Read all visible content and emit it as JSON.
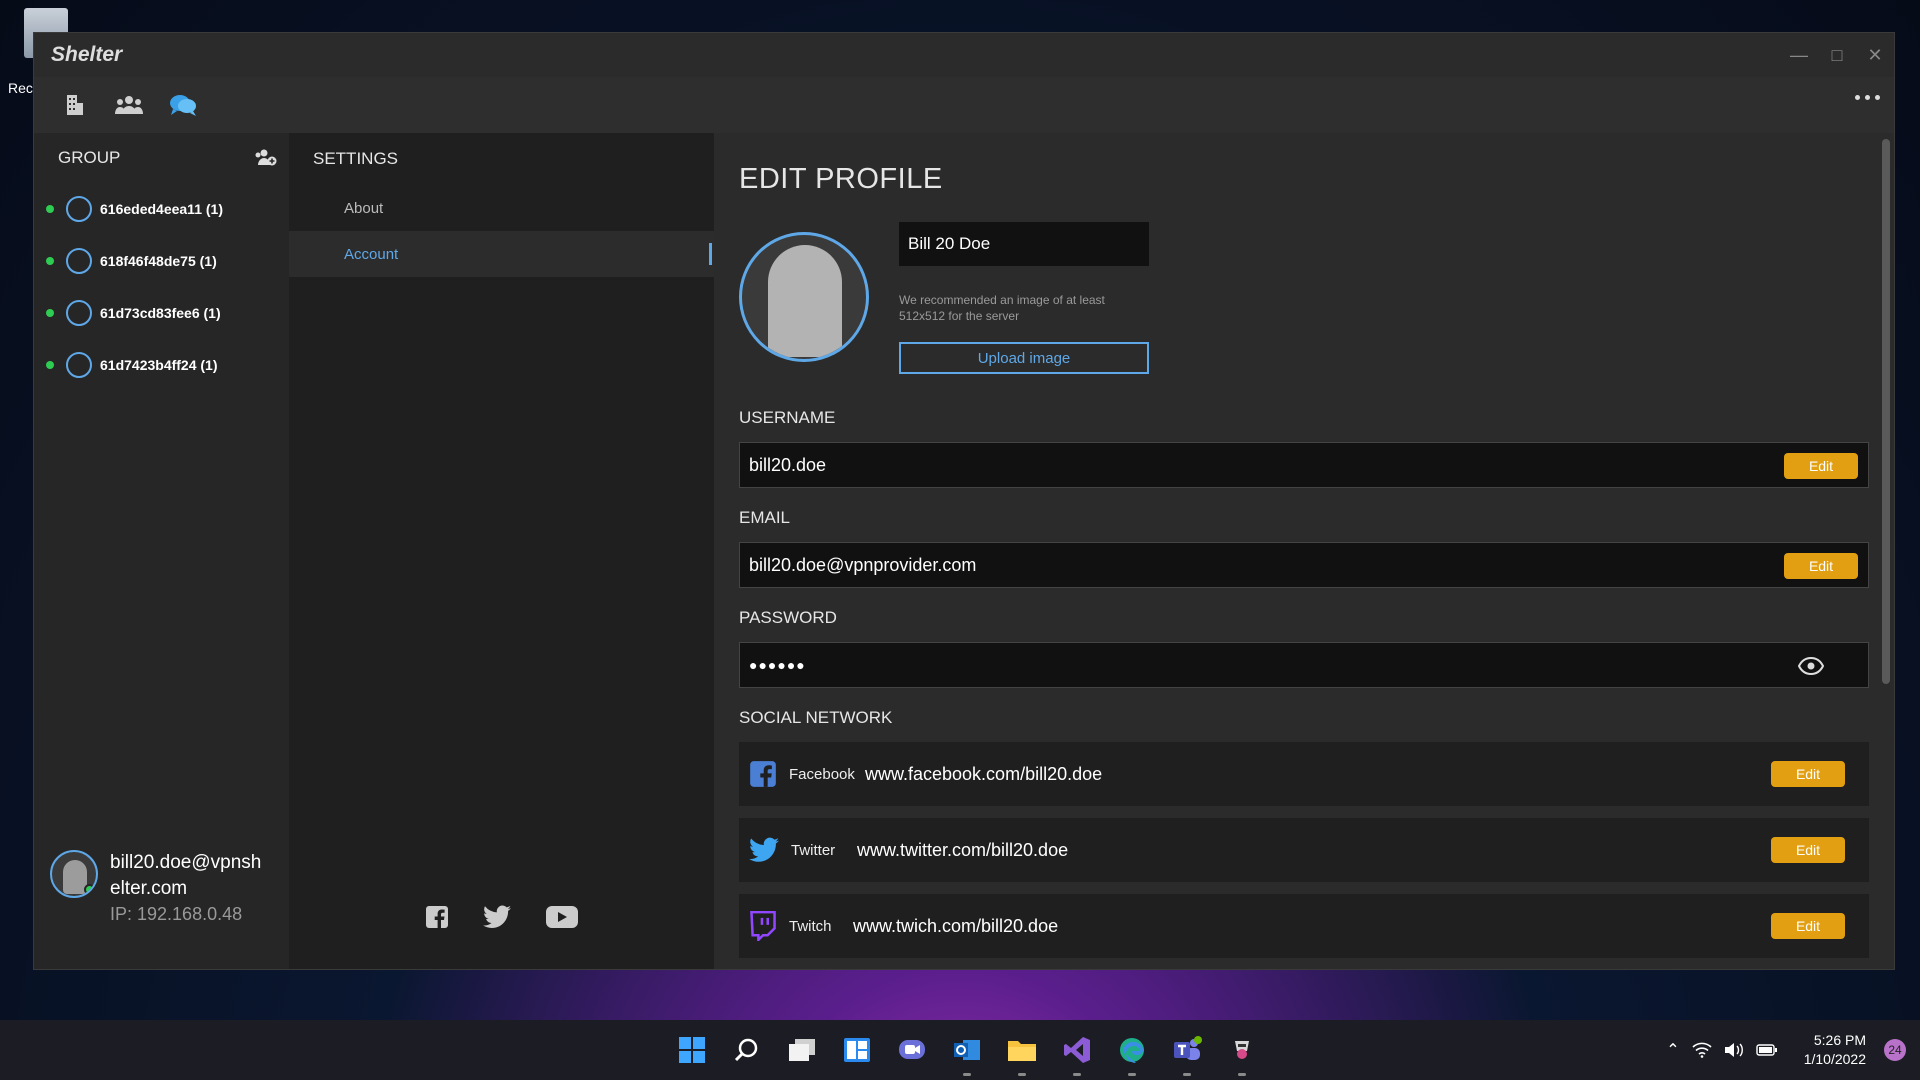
{
  "desktop": {
    "recycle_label": "Rec"
  },
  "window": {
    "title": "Shelter"
  },
  "toolbar": {
    "icons": [
      "building-icon",
      "group-icon",
      "chat-icon"
    ]
  },
  "groups": {
    "header": "GROUP",
    "items": [
      {
        "name": "616eded4eea11 (1)"
      },
      {
        "name": "618f46f48de75 (1)"
      },
      {
        "name": "61d73cd83fee6 (1)"
      },
      {
        "name": "61d7423b4ff24 (1)"
      }
    ]
  },
  "current_user": {
    "email": "bill20.doe@vpnshelter.com",
    "ip": "IP: 192.168.0.48"
  },
  "settings": {
    "title": "SETTINGS",
    "items": [
      {
        "label": "About",
        "active": false
      },
      {
        "label": "Account",
        "active": true
      }
    ]
  },
  "profile": {
    "title": "EDIT PROFILE",
    "display_name": "Bill 20 Doe",
    "hint": "We recommended an image of at least 512x512 for the server",
    "upload_label": "Upload image",
    "username_label": "USERNAME",
    "username": "bill20.doe",
    "email_label": "EMAIL",
    "email": "bill20.doe@vpnprovider.com",
    "password_label": "PASSWORD",
    "password_masked": "●●●●●●",
    "edit_label": "Edit",
    "social_label": "SOCIAL NETWORK",
    "social": [
      {
        "network": "Facebook",
        "url": "www.facebook.com/bill20.doe",
        "color": "#4a7fd4"
      },
      {
        "network": "Twitter",
        "url": "www.twitter.com/bill20.doe",
        "color": "#3ea6f0"
      },
      {
        "network": "Twitch",
        "url": "www.twich.com/bill20.doe",
        "color": "#9146ff"
      }
    ]
  },
  "colors": {
    "accent": "#5fa8e8",
    "edit": "#e29f12",
    "online": "#2ecc52"
  },
  "taskbar": {
    "apps": [
      "windows-start-icon",
      "search-icon",
      "task-view-icon",
      "widgets-icon",
      "teams-chat-icon",
      "outlook-icon",
      "file-explorer-icon",
      "visual-studio-icon",
      "edge-canary-icon",
      "teams-icon",
      "shelter-app-icon"
    ],
    "time": "5:26 PM",
    "date": "1/10/2022",
    "notifications": "24"
  }
}
